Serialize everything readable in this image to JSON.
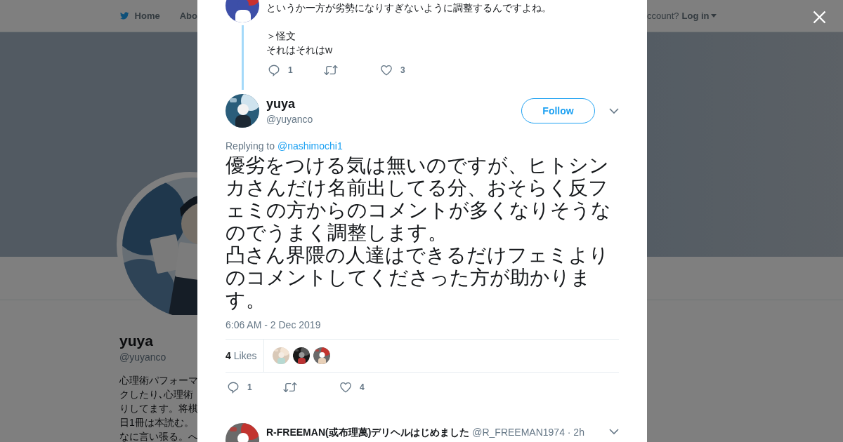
{
  "background_page": {
    "nav": {
      "home": "Home",
      "about": "Abo",
      "account_prompt": "ccount?",
      "login": "Log in"
    },
    "profile": {
      "name": "yuya",
      "handle": "@yuyanco",
      "bio_lines": [
        "心理術パフォーマ",
        "クしたり､心理術",
        "りしてます。将棋",
        "日1冊は本読む。",
        "なに言い張る。へ"
      ]
    }
  },
  "modal": {
    "previous_tweet": {
      "paragraphs": [
        {
          "lines": [
            "というか一方が劣勢になりすぎないように調整するんですよね。"
          ]
        },
        {
          "lines": [
            "＞怪文",
            "それはそれはw"
          ]
        }
      ],
      "replies": "1",
      "likes": "3"
    },
    "tweet": {
      "name": "yuya",
      "handle": "@yuyanco",
      "follow": "Follow",
      "replying_label": "Replying to",
      "replying_to": "@nashimochi1",
      "text_paragraphs": [
        "優劣をつける気は無いのですが、ヒトシンカさんだけ名前出してる分、おそらく反フェミの方からのコメントが多くなりそうなのでうまく調整します。",
        "凸さん界隈の人達はできるだけフェミよりのコメントしてくださった方が助かります。"
      ],
      "timestamp": "6:06 AM - 2 Dec 2019",
      "likes_count": "4",
      "likes_label": "Likes",
      "likers": [
        {
          "kind": "picture"
        },
        {
          "kind": "picture"
        },
        {
          "kind": "picture"
        }
      ],
      "replies": "1",
      "likes": "4"
    },
    "next_tweet": {
      "name": "R-FREEMAN(或布理萬)デリヘルはじめました",
      "handle": "@R_FREEMAN1974",
      "time": "· 2h"
    }
  }
}
